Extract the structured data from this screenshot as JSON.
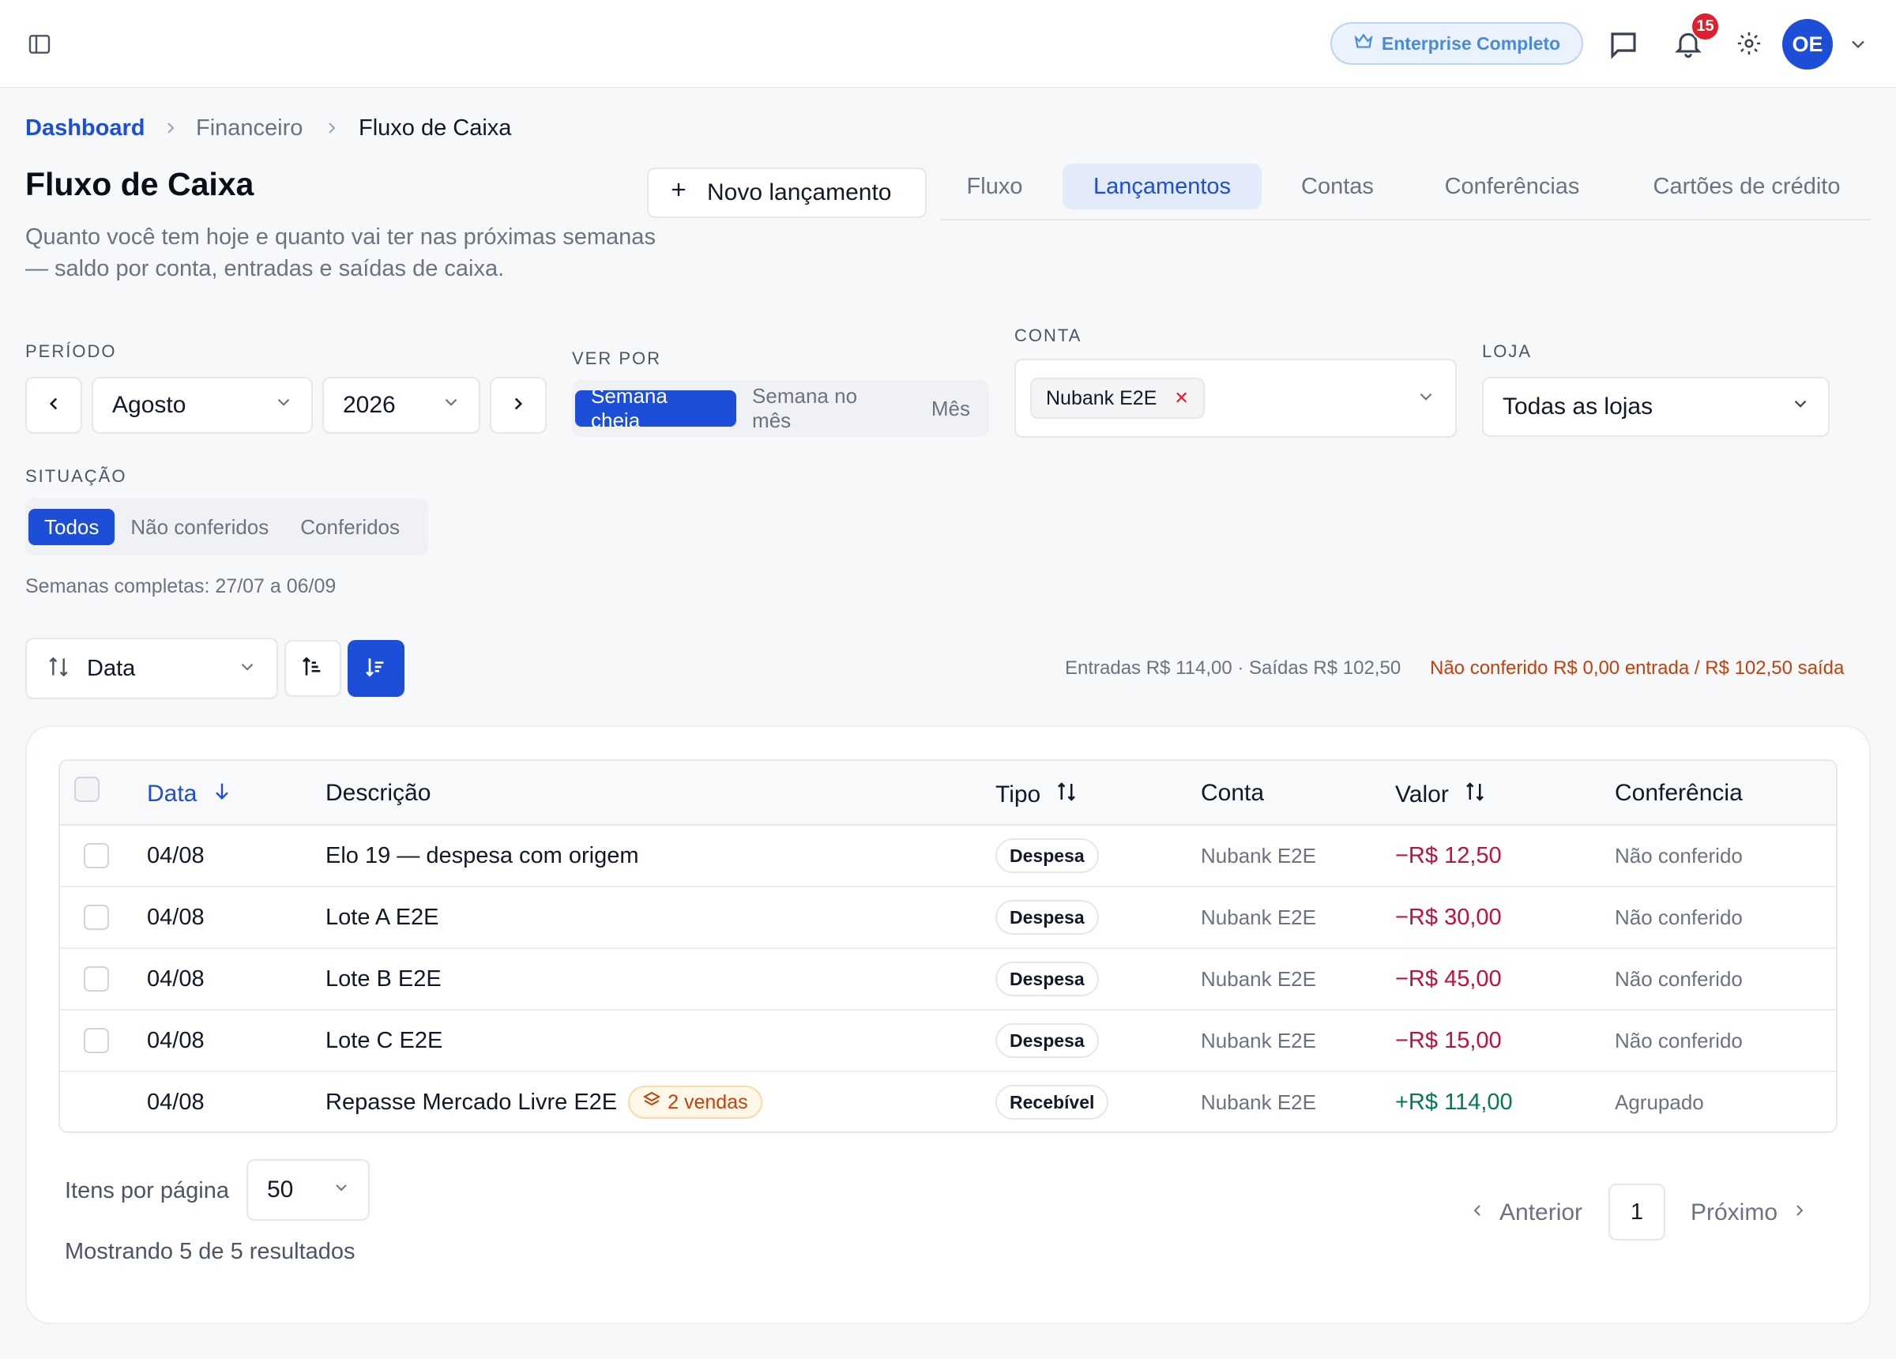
{
  "header": {
    "plan_label": "Enterprise Completo",
    "notifications_count": "15",
    "avatar_initials": "OE"
  },
  "breadcrumb": [
    "Dashboard",
    "Financeiro",
    "Fluxo de Caixa"
  ],
  "page": {
    "title": "Fluxo de Caixa",
    "subtitle": "Quanto você tem hoje e quanto vai ter nas próximas semanas — saldo por conta, entradas e saídas de caixa.",
    "new_entry_label": "Novo lançamento"
  },
  "tabs": [
    {
      "label": "Fluxo",
      "active": false
    },
    {
      "label": "Lançamentos",
      "active": true
    },
    {
      "label": "Contas",
      "active": false
    },
    {
      "label": "Conferências",
      "active": false
    },
    {
      "label": "Cartões de crédito",
      "active": false
    }
  ],
  "filters": {
    "period_label": "PERÍODO",
    "month": "Agosto",
    "year": "2026",
    "view_label": "VER POR",
    "view_options": [
      "Semana cheia",
      "Semana no mês",
      "Mês"
    ],
    "view_selected": "Semana cheia",
    "account_label": "CONTA",
    "account_chip": "Nubank E2E",
    "store_label": "LOJA",
    "store_value": "Todas as lojas",
    "status_label": "SITUAÇÃO",
    "status_options": [
      "Todos",
      "Não conferidos",
      "Conferidos"
    ],
    "status_selected": "Todos",
    "weeks_note": "Semanas completas: 27/07 a 06/09"
  },
  "sort": {
    "field": "Data"
  },
  "totals": {
    "summary": "Entradas R$ 114,00 · Saídas R$ 102,50",
    "unchecked": "Não conferido R$ 0,00 entrada / R$ 102,50 saída"
  },
  "table": {
    "columns": [
      "Data",
      "Descrição",
      "Tipo",
      "Conta",
      "Valor",
      "Conferência"
    ],
    "rows": [
      {
        "date": "04/08",
        "description": "Elo 19 — despesa com origem",
        "type": "Despesa",
        "account": "Nubank E2E",
        "value": "−R$ 12,50",
        "status": "Não conferido",
        "positive": false,
        "checkbox": true
      },
      {
        "date": "04/08",
        "description": "Lote A E2E",
        "type": "Despesa",
        "account": "Nubank E2E",
        "value": "−R$ 30,00",
        "status": "Não conferido",
        "positive": false,
        "checkbox": true
      },
      {
        "date": "04/08",
        "description": "Lote B E2E",
        "type": "Despesa",
        "account": "Nubank E2E",
        "value": "−R$ 45,00",
        "status": "Não conferido",
        "positive": false,
        "checkbox": true
      },
      {
        "date": "04/08",
        "description": "Lote C E2E",
        "type": "Despesa",
        "account": "Nubank E2E",
        "value": "−R$ 15,00",
        "status": "Não conferido",
        "positive": false,
        "checkbox": true
      },
      {
        "date": "04/08",
        "description": "Repasse Mercado Livre E2E",
        "badge": "2 vendas",
        "type": "Recebível",
        "account": "Nubank E2E",
        "value": "+R$ 114,00",
        "status": "Agrupado",
        "positive": true,
        "checkbox": false
      }
    ]
  },
  "pagination": {
    "per_page_label": "Itens por página",
    "per_page_value": "50",
    "showing": "Mostrando 5 de 5 resultados",
    "prev_label": "Anterior",
    "current_page": "1",
    "next_label": "Próximo"
  },
  "colors": {
    "primary": "#1d4ed8",
    "negative": "#be123c",
    "positive": "#047857",
    "warning": "#c2410c"
  }
}
